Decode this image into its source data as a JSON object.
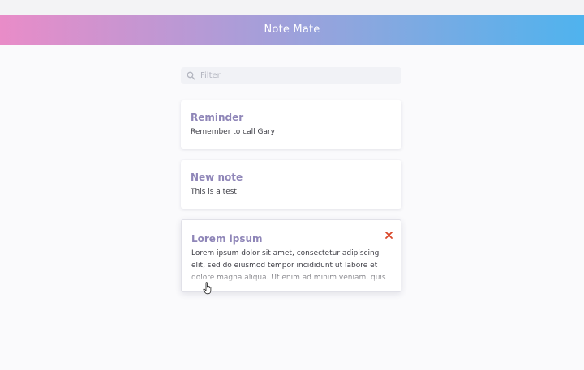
{
  "app": {
    "title": "Note Mate"
  },
  "filter": {
    "placeholder": "Filter",
    "value": "",
    "icon": "search-icon"
  },
  "notes": [
    {
      "title": "Reminder",
      "body": "Remember to call Gary"
    },
    {
      "title": "New note",
      "body": "This is a test"
    },
    {
      "title": "Lorem ipsum",
      "body": "Lorem ipsum dolor sit amet, consectetur adipiscing elit, sed do eiusmod tempor incididunt ut labore et dolore magna aliqua. Ut enim ad minim veniam, quis nostrud exercitation"
    }
  ],
  "icons": {
    "delete": "close-icon",
    "cursor": "hand-pointer-icon"
  },
  "colors": {
    "gradient_start": "#e98cc8",
    "gradient_end": "#4fb3ee",
    "note_title": "#8f86b8",
    "delete_accent": "#d9482b"
  }
}
